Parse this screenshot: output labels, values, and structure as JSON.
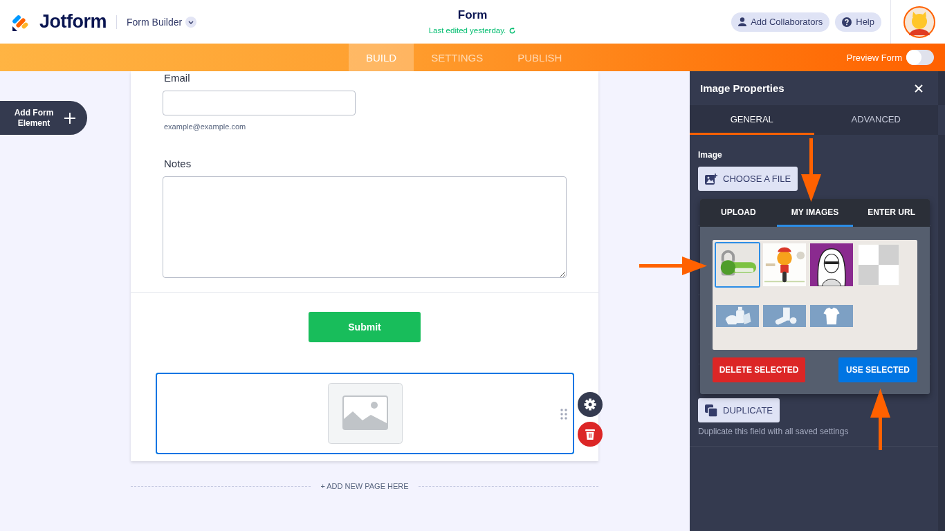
{
  "header": {
    "logo": "Jotform",
    "product": "Form Builder",
    "form_title": "Form",
    "last_edited": "Last edited yesterday.",
    "buttons": [
      {
        "label": "Add Collaborators",
        "kind": "person"
      },
      {
        "label": "Help",
        "kind": "help"
      }
    ]
  },
  "nav": {
    "tabs": [
      {
        "label": "BUILD",
        "selected": true
      },
      {
        "label": "SETTINGS",
        "selected": false
      },
      {
        "label": "PUBLISH",
        "selected": false
      }
    ],
    "preview": {
      "label": "Preview Form",
      "on": false
    }
  },
  "add_element": {
    "label": "Add Form Element"
  },
  "form": {
    "fields": [
      {
        "kind": "email",
        "label": "Email",
        "hint": "example@example.com"
      },
      {
        "kind": "textarea",
        "label": "Notes"
      }
    ],
    "submit": "Submit",
    "add_page": "+ ADD NEW PAGE HERE"
  },
  "panel": {
    "title": "Image Properties",
    "tabs": [
      {
        "label": "GENERAL",
        "selected": true
      },
      {
        "label": "ADVANCED",
        "selected": false
      }
    ],
    "image_label": "Image",
    "choose_file": "CHOOSE A FILE",
    "duplicate": "DUPLICATE",
    "duplicate_note": "Duplicate this field with all saved settings"
  },
  "image_picker": {
    "tabs": [
      {
        "label": "UPLOAD",
        "selected": false
      },
      {
        "label": "MY IMAGES",
        "selected": true
      },
      {
        "label": "ENTER URL",
        "selected": false
      }
    ],
    "images": [
      {
        "kind": "badge",
        "selected": true
      },
      {
        "kind": "cyclist",
        "selected": false
      },
      {
        "kind": "portrait",
        "selected": false
      },
      {
        "kind": "transparent",
        "selected": false
      },
      {
        "kind": "hygiene",
        "selected": false
      },
      {
        "kind": "groceries",
        "selected": false
      },
      {
        "kind": "shirt",
        "selected": false
      }
    ],
    "buttons": [
      {
        "label": "DELETE SELECTED",
        "kind": "delete"
      },
      {
        "label": "USE SELECTED",
        "kind": "use"
      }
    ]
  }
}
